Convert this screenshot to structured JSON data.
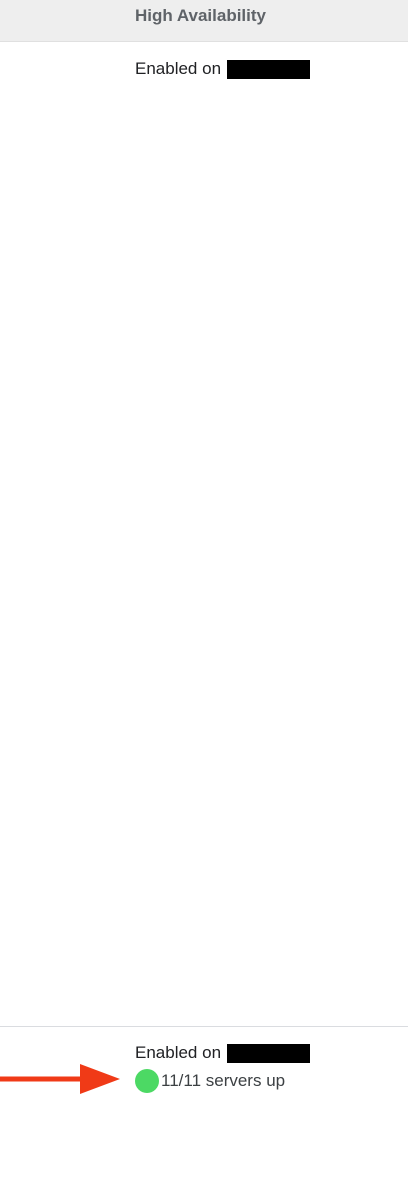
{
  "header": {
    "title": "High Availability"
  },
  "rows": [
    {
      "status": "Enabled on"
    },
    {
      "status": "Enabled on",
      "servers_text": "11/11 servers up",
      "servers_up": 11,
      "servers_total": 11
    }
  ],
  "icons": {
    "status_dot": "status-dot-icon",
    "annotation_arrow": "arrow-right-icon"
  },
  "colors": {
    "status_dot": "#4cd964",
    "annotation_arrow": "#f03a17",
    "redaction": "#000000"
  }
}
